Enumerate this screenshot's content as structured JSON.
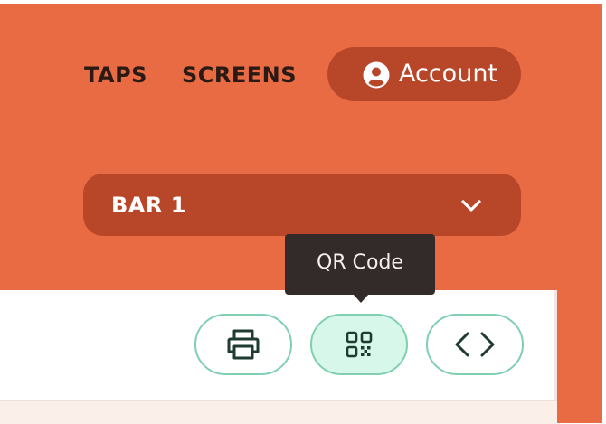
{
  "nav": {
    "taps_label": "TAPS",
    "screens_label": "SCREENS",
    "account_label": "Account",
    "account_icon": "user-circle-icon"
  },
  "location_select": {
    "selected": "BAR 1",
    "icon": "chevron-down-icon"
  },
  "toolbar": {
    "buttons": [
      {
        "name": "print",
        "icon": "printer-icon"
      },
      {
        "name": "qr-code",
        "icon": "qr-code-icon",
        "active": true
      },
      {
        "name": "embed-code",
        "icon": "code-icon"
      }
    ]
  },
  "tooltip": {
    "text": "QR Code"
  },
  "colors": {
    "header_bg": "#e96b44",
    "pill_bg": "#b8472a",
    "button_border": "#7fcfb0",
    "button_active_bg": "#d6f7ea",
    "tooltip_bg": "#332b29"
  }
}
